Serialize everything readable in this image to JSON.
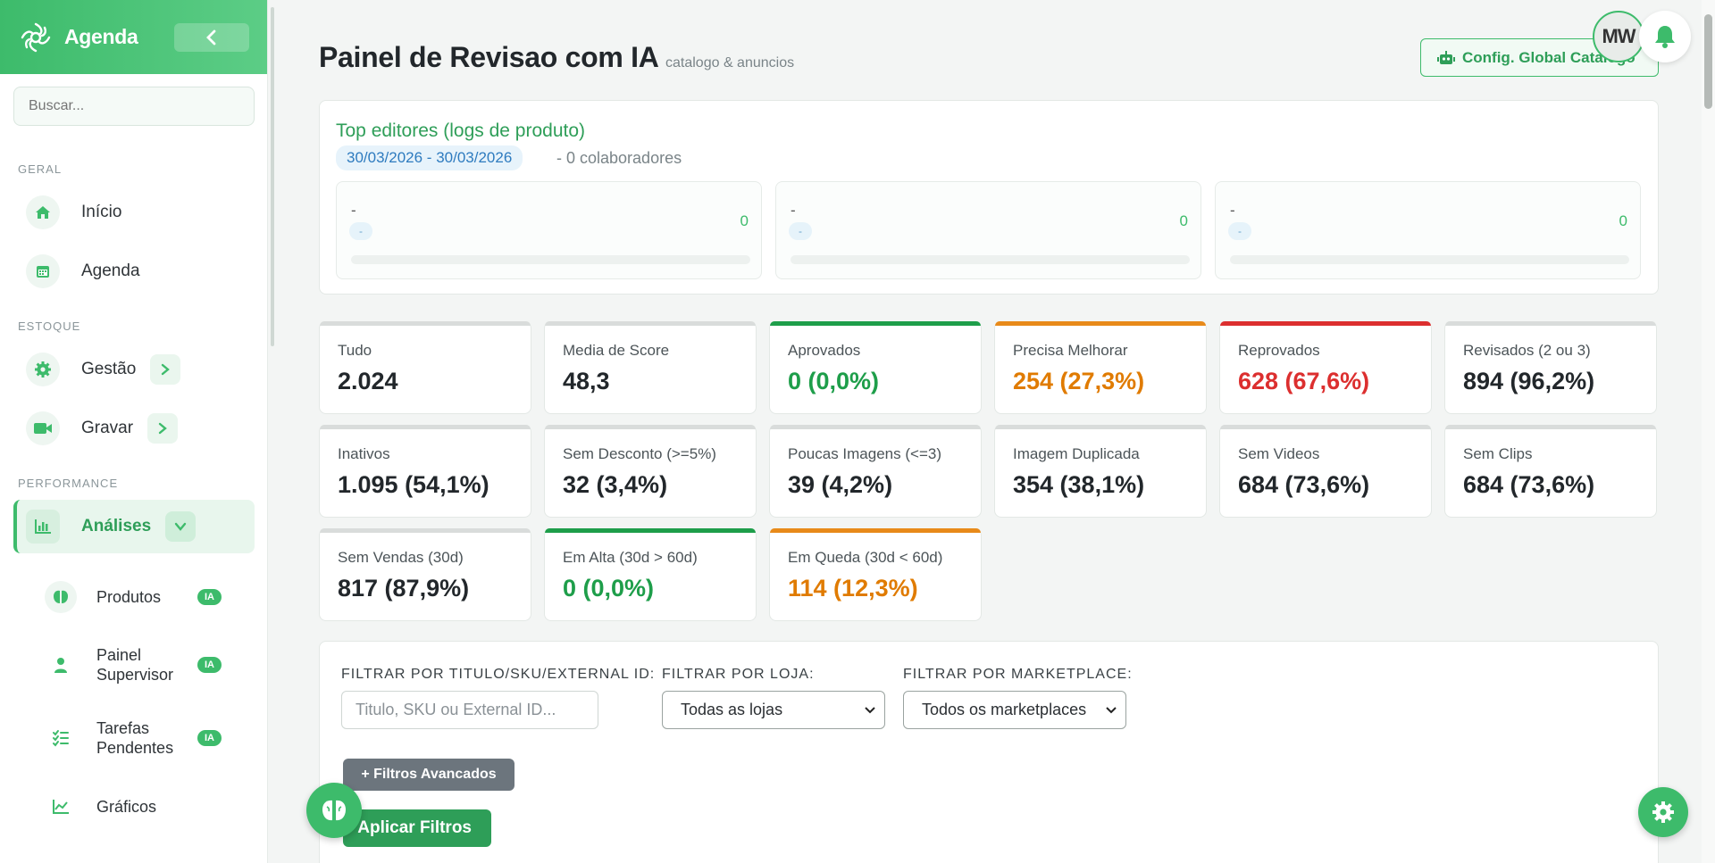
{
  "app": {
    "name": "Agenda"
  },
  "search": {
    "placeholder": "Buscar..."
  },
  "sidebar": {
    "sections": [
      "GERAL",
      "ESTOQUE",
      "PERFORMANCE"
    ],
    "items": [
      {
        "label": "Início",
        "icon": "home-icon"
      },
      {
        "label": "Agenda",
        "icon": "calendar-icon"
      },
      {
        "label": "Gestão",
        "icon": "gear-icon"
      },
      {
        "label": "Gravar",
        "icon": "video-icon"
      },
      {
        "label": "Análises",
        "icon": "chart-bar-icon"
      }
    ],
    "sub_items": [
      {
        "label": "Produtos",
        "badge": "IA",
        "icon": "brain-icon"
      },
      {
        "label": "Painel Supervisor",
        "badge": "IA",
        "icon": "user-icon"
      },
      {
        "label": "Tarefas Pendentes",
        "badge": "IA",
        "icon": "tasks-icon"
      },
      {
        "label": "Gráficos",
        "icon": "line-chart-icon"
      }
    ]
  },
  "header": {
    "title": "Painel de Revisao com IA",
    "subtitle": "catalogo & anuncios",
    "config_button": "Config. Global Catalogo",
    "avatar_initials": "MW"
  },
  "editors": {
    "title": "Top editores (logs de produto)",
    "date_range": "30/03/2026 - 30/03/2026",
    "count_text": "- 0 colaboradores",
    "boxes": [
      {
        "name": "-",
        "pill": "-",
        "value": "0"
      },
      {
        "name": "-",
        "pill": "-",
        "value": "0"
      },
      {
        "name": "-",
        "pill": "-",
        "value": "0"
      }
    ]
  },
  "stats": [
    {
      "label": "Tudo",
      "value": "2.024"
    },
    {
      "label": "Media de Score",
      "value": "48,3"
    },
    {
      "label": "Aprovados",
      "value": "0 (0,0%)"
    },
    {
      "label": "Precisa Melhorar",
      "value": "254 (27,3%)"
    },
    {
      "label": "Reprovados",
      "value": "628 (67,6%)"
    },
    {
      "label": "Revisados (2 ou 3)",
      "value": "894 (96,2%)"
    },
    {
      "label": "Inativos",
      "value": "1.095 (54,1%)"
    },
    {
      "label": "Sem Desconto (>=5%)",
      "value": "32 (3,4%)"
    },
    {
      "label": "Poucas Imagens (<=3)",
      "value": "39 (4,2%)"
    },
    {
      "label": "Imagem Duplicada",
      "value": "354 (38,1%)"
    },
    {
      "label": "Sem Videos",
      "value": "684 (73,6%)"
    },
    {
      "label": "Sem Clips",
      "value": "684 (73,6%)"
    },
    {
      "label": "Sem Vendas (30d)",
      "value": "817 (87,9%)"
    },
    {
      "label": "Em Alta (30d > 60d)",
      "value": "0 (0,0%)"
    },
    {
      "label": "Em Queda (30d < 60d)",
      "value": "114 (12,3%)"
    }
  ],
  "colors": {
    "accent": "#3dbb6b",
    "green": "#1e9e4a",
    "orange": "#e07b00",
    "red": "#dc2f2f",
    "gray": "#d9dcdb"
  },
  "filters": {
    "title_label": "FILTRAR POR TITULO/SKU/EXTERNAL ID:",
    "title_placeholder": "Titulo, SKU ou External ID...",
    "store_label": "FILTRAR POR LOJA:",
    "store_value": "Todas as lojas",
    "marketplace_label": "FILTRAR POR MARKETPLACE:",
    "marketplace_value": "Todos os marketplaces",
    "advanced_button": "+ Filtros Avancados",
    "apply_button": "Aplicar Filtros"
  }
}
